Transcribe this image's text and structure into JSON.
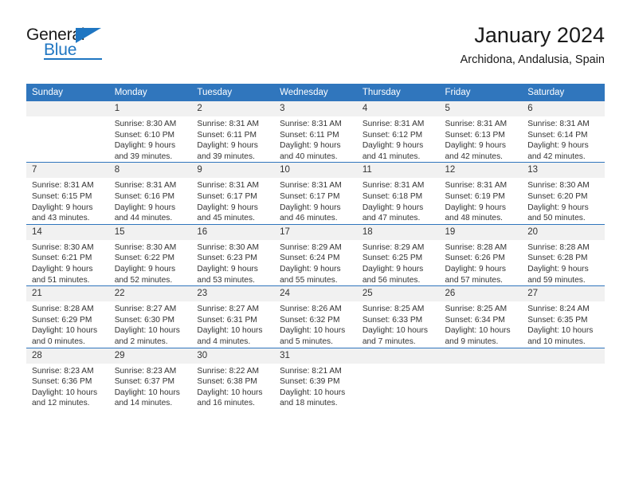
{
  "brand": {
    "name_part1": "General",
    "name_part2": "Blue",
    "accent_color": "#1f76c2",
    "triangle_icon": "triangle-right-icon"
  },
  "header": {
    "title": "January 2024",
    "subtitle": "Archidona, Andalusia, Spain"
  },
  "calendar": {
    "header_bg": "#3076bd",
    "daynum_bg": "#f1f1f1",
    "weekdays": [
      "Sunday",
      "Monday",
      "Tuesday",
      "Wednesday",
      "Thursday",
      "Friday",
      "Saturday"
    ],
    "weeks": [
      [
        {
          "day": "",
          "sunrise": "",
          "sunset": "",
          "daylight_line1": "",
          "daylight_line2": ""
        },
        {
          "day": "1",
          "sunrise": "Sunrise: 8:30 AM",
          "sunset": "Sunset: 6:10 PM",
          "daylight_line1": "Daylight: 9 hours",
          "daylight_line2": "and 39 minutes."
        },
        {
          "day": "2",
          "sunrise": "Sunrise: 8:31 AM",
          "sunset": "Sunset: 6:11 PM",
          "daylight_line1": "Daylight: 9 hours",
          "daylight_line2": "and 39 minutes."
        },
        {
          "day": "3",
          "sunrise": "Sunrise: 8:31 AM",
          "sunset": "Sunset: 6:11 PM",
          "daylight_line1": "Daylight: 9 hours",
          "daylight_line2": "and 40 minutes."
        },
        {
          "day": "4",
          "sunrise": "Sunrise: 8:31 AM",
          "sunset": "Sunset: 6:12 PM",
          "daylight_line1": "Daylight: 9 hours",
          "daylight_line2": "and 41 minutes."
        },
        {
          "day": "5",
          "sunrise": "Sunrise: 8:31 AM",
          "sunset": "Sunset: 6:13 PM",
          "daylight_line1": "Daylight: 9 hours",
          "daylight_line2": "and 42 minutes."
        },
        {
          "day": "6",
          "sunrise": "Sunrise: 8:31 AM",
          "sunset": "Sunset: 6:14 PM",
          "daylight_line1": "Daylight: 9 hours",
          "daylight_line2": "and 42 minutes."
        }
      ],
      [
        {
          "day": "7",
          "sunrise": "Sunrise: 8:31 AM",
          "sunset": "Sunset: 6:15 PM",
          "daylight_line1": "Daylight: 9 hours",
          "daylight_line2": "and 43 minutes."
        },
        {
          "day": "8",
          "sunrise": "Sunrise: 8:31 AM",
          "sunset": "Sunset: 6:16 PM",
          "daylight_line1": "Daylight: 9 hours",
          "daylight_line2": "and 44 minutes."
        },
        {
          "day": "9",
          "sunrise": "Sunrise: 8:31 AM",
          "sunset": "Sunset: 6:17 PM",
          "daylight_line1": "Daylight: 9 hours",
          "daylight_line2": "and 45 minutes."
        },
        {
          "day": "10",
          "sunrise": "Sunrise: 8:31 AM",
          "sunset": "Sunset: 6:17 PM",
          "daylight_line1": "Daylight: 9 hours",
          "daylight_line2": "and 46 minutes."
        },
        {
          "day": "11",
          "sunrise": "Sunrise: 8:31 AM",
          "sunset": "Sunset: 6:18 PM",
          "daylight_line1": "Daylight: 9 hours",
          "daylight_line2": "and 47 minutes."
        },
        {
          "day": "12",
          "sunrise": "Sunrise: 8:31 AM",
          "sunset": "Sunset: 6:19 PM",
          "daylight_line1": "Daylight: 9 hours",
          "daylight_line2": "and 48 minutes."
        },
        {
          "day": "13",
          "sunrise": "Sunrise: 8:30 AM",
          "sunset": "Sunset: 6:20 PM",
          "daylight_line1": "Daylight: 9 hours",
          "daylight_line2": "and 50 minutes."
        }
      ],
      [
        {
          "day": "14",
          "sunrise": "Sunrise: 8:30 AM",
          "sunset": "Sunset: 6:21 PM",
          "daylight_line1": "Daylight: 9 hours",
          "daylight_line2": "and 51 minutes."
        },
        {
          "day": "15",
          "sunrise": "Sunrise: 8:30 AM",
          "sunset": "Sunset: 6:22 PM",
          "daylight_line1": "Daylight: 9 hours",
          "daylight_line2": "and 52 minutes."
        },
        {
          "day": "16",
          "sunrise": "Sunrise: 8:30 AM",
          "sunset": "Sunset: 6:23 PM",
          "daylight_line1": "Daylight: 9 hours",
          "daylight_line2": "and 53 minutes."
        },
        {
          "day": "17",
          "sunrise": "Sunrise: 8:29 AM",
          "sunset": "Sunset: 6:24 PM",
          "daylight_line1": "Daylight: 9 hours",
          "daylight_line2": "and 55 minutes."
        },
        {
          "day": "18",
          "sunrise": "Sunrise: 8:29 AM",
          "sunset": "Sunset: 6:25 PM",
          "daylight_line1": "Daylight: 9 hours",
          "daylight_line2": "and 56 minutes."
        },
        {
          "day": "19",
          "sunrise": "Sunrise: 8:28 AM",
          "sunset": "Sunset: 6:26 PM",
          "daylight_line1": "Daylight: 9 hours",
          "daylight_line2": "and 57 minutes."
        },
        {
          "day": "20",
          "sunrise": "Sunrise: 8:28 AM",
          "sunset": "Sunset: 6:28 PM",
          "daylight_line1": "Daylight: 9 hours",
          "daylight_line2": "and 59 minutes."
        }
      ],
      [
        {
          "day": "21",
          "sunrise": "Sunrise: 8:28 AM",
          "sunset": "Sunset: 6:29 PM",
          "daylight_line1": "Daylight: 10 hours",
          "daylight_line2": "and 0 minutes."
        },
        {
          "day": "22",
          "sunrise": "Sunrise: 8:27 AM",
          "sunset": "Sunset: 6:30 PM",
          "daylight_line1": "Daylight: 10 hours",
          "daylight_line2": "and 2 minutes."
        },
        {
          "day": "23",
          "sunrise": "Sunrise: 8:27 AM",
          "sunset": "Sunset: 6:31 PM",
          "daylight_line1": "Daylight: 10 hours",
          "daylight_line2": "and 4 minutes."
        },
        {
          "day": "24",
          "sunrise": "Sunrise: 8:26 AM",
          "sunset": "Sunset: 6:32 PM",
          "daylight_line1": "Daylight: 10 hours",
          "daylight_line2": "and 5 minutes."
        },
        {
          "day": "25",
          "sunrise": "Sunrise: 8:25 AM",
          "sunset": "Sunset: 6:33 PM",
          "daylight_line1": "Daylight: 10 hours",
          "daylight_line2": "and 7 minutes."
        },
        {
          "day": "26",
          "sunrise": "Sunrise: 8:25 AM",
          "sunset": "Sunset: 6:34 PM",
          "daylight_line1": "Daylight: 10 hours",
          "daylight_line2": "and 9 minutes."
        },
        {
          "day": "27",
          "sunrise": "Sunrise: 8:24 AM",
          "sunset": "Sunset: 6:35 PM",
          "daylight_line1": "Daylight: 10 hours",
          "daylight_line2": "and 10 minutes."
        }
      ],
      [
        {
          "day": "28",
          "sunrise": "Sunrise: 8:23 AM",
          "sunset": "Sunset: 6:36 PM",
          "daylight_line1": "Daylight: 10 hours",
          "daylight_line2": "and 12 minutes."
        },
        {
          "day": "29",
          "sunrise": "Sunrise: 8:23 AM",
          "sunset": "Sunset: 6:37 PM",
          "daylight_line1": "Daylight: 10 hours",
          "daylight_line2": "and 14 minutes."
        },
        {
          "day": "30",
          "sunrise": "Sunrise: 8:22 AM",
          "sunset": "Sunset: 6:38 PM",
          "daylight_line1": "Daylight: 10 hours",
          "daylight_line2": "and 16 minutes."
        },
        {
          "day": "31",
          "sunrise": "Sunrise: 8:21 AM",
          "sunset": "Sunset: 6:39 PM",
          "daylight_line1": "Daylight: 10 hours",
          "daylight_line2": "and 18 minutes."
        },
        {
          "day": "",
          "sunrise": "",
          "sunset": "",
          "daylight_line1": "",
          "daylight_line2": ""
        },
        {
          "day": "",
          "sunrise": "",
          "sunset": "",
          "daylight_line1": "",
          "daylight_line2": ""
        },
        {
          "day": "",
          "sunrise": "",
          "sunset": "",
          "daylight_line1": "",
          "daylight_line2": ""
        }
      ]
    ]
  }
}
